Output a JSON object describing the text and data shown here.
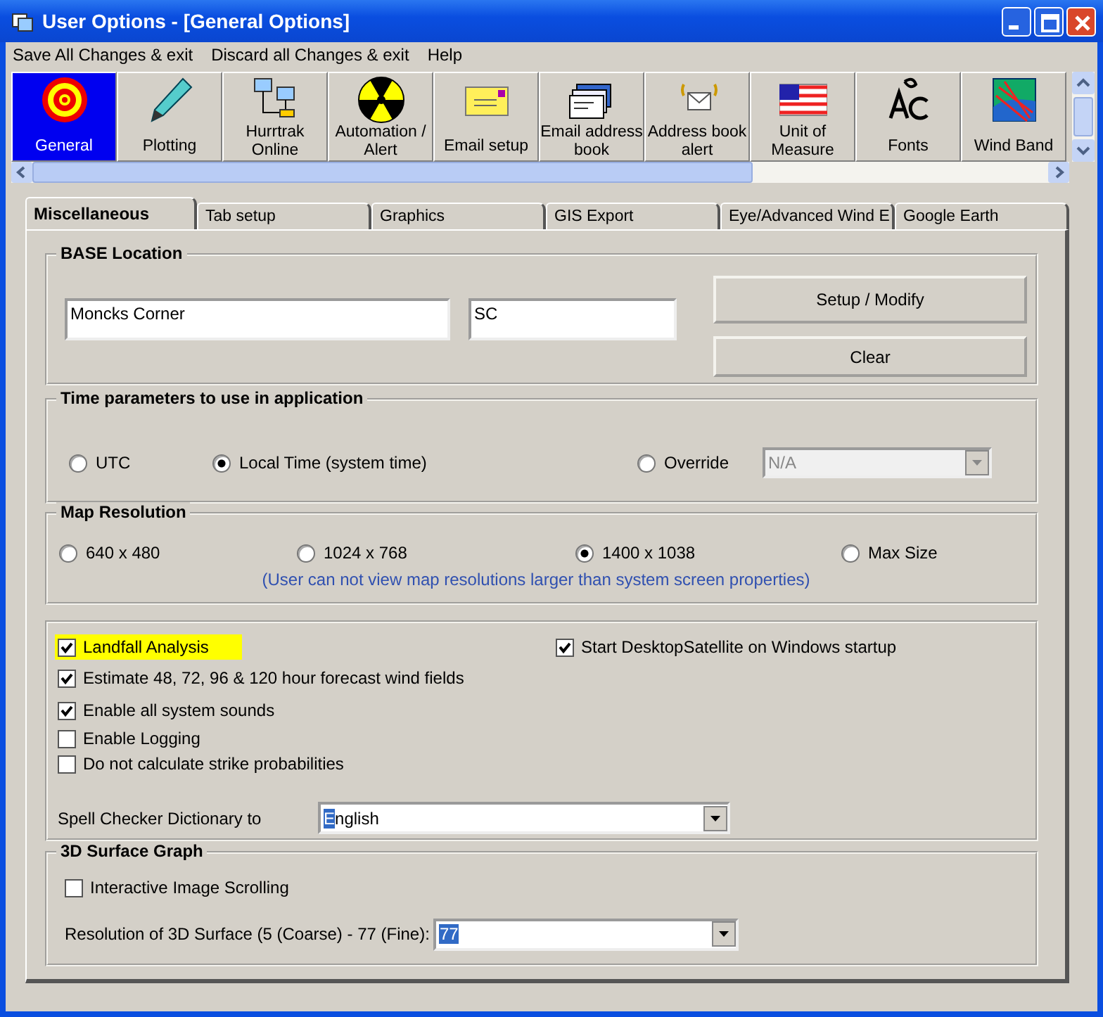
{
  "window": {
    "title": "User Options - [General Options]"
  },
  "menu": [
    "Save All Changes & exit",
    "Discard all Changes & exit",
    "Help"
  ],
  "toolbar": [
    {
      "label": "General",
      "selected": true
    },
    {
      "label": "Plotting",
      "selected": false
    },
    {
      "label": "Hurrtrak Online",
      "selected": false
    },
    {
      "label": "Automation / Alert",
      "selected": false
    },
    {
      "label": "Email setup",
      "selected": false
    },
    {
      "label": "Email address book",
      "selected": false
    },
    {
      "label": "Address book alert",
      "selected": false
    },
    {
      "label": "Unit of Measure",
      "selected": false
    },
    {
      "label": "Fonts",
      "selected": false
    },
    {
      "label": "Wind Band",
      "selected": false
    }
  ],
  "tabs": [
    {
      "label": "Miscellaneous",
      "selected": true
    },
    {
      "label": "Tab setup",
      "selected": false
    },
    {
      "label": "Graphics",
      "selected": false
    },
    {
      "label": "GIS Export",
      "selected": false
    },
    {
      "label": "Eye/Advanced Wind E",
      "selected": false
    },
    {
      "label": "Google Earth",
      "selected": false
    }
  ],
  "base_location": {
    "title": "BASE Location",
    "city": "Moncks Corner",
    "state": "SC",
    "buttons": [
      "Setup / Modify",
      "Clear"
    ]
  },
  "time_parameters": {
    "title": "Time parameters to use in application",
    "options": [
      {
        "label": "UTC",
        "selected": false
      },
      {
        "label": "Local Time (system time)",
        "selected": true
      },
      {
        "label": "Override",
        "selected": false
      }
    ],
    "override_value": "N/A",
    "override_disabled": true
  },
  "map_resolution": {
    "title": "Map Resolution",
    "options": [
      {
        "label": "640 x 480",
        "selected": false
      },
      {
        "label": "1024 x 768",
        "selected": false
      },
      {
        "label": "1400 x 1038",
        "selected": true
      },
      {
        "label": "Max Size",
        "selected": false
      }
    ],
    "note": "(User can not view map resolutions larger than system screen properties)"
  },
  "options": {
    "checkboxes": [
      {
        "label": "Landfall Analysis",
        "checked": true,
        "highlighted": true
      },
      {
        "label": "Estimate 48, 72, 96 & 120 hour forecast wind fields",
        "checked": true,
        "highlighted": false
      },
      {
        "label": "Enable all system sounds",
        "checked": true,
        "highlighted": false
      },
      {
        "label": "Enable Logging",
        "checked": false,
        "highlighted": false
      },
      {
        "label": "Do not calculate strike probabilities",
        "checked": false,
        "highlighted": false
      }
    ],
    "startup": {
      "label": "Start DesktopSatellite on Windows startup",
      "checked": true
    },
    "spell_checker": {
      "label": "Spell Checker Dictionary to",
      "value": "English"
    }
  },
  "surface_graph": {
    "title": "3D Surface Graph",
    "checkbox": {
      "label": "Interactive Image Scrolling",
      "checked": false
    },
    "resolution": {
      "label": "Resolution of 3D Surface (5 (Coarse) - 77 (Fine):",
      "value": "77"
    }
  }
}
